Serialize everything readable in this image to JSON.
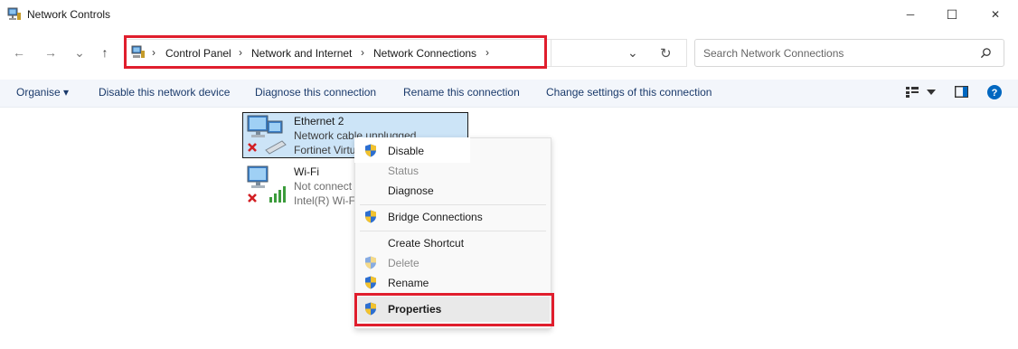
{
  "window": {
    "title": "Network Controls",
    "controls": {
      "minimize": "─",
      "maximize": "☐",
      "close": "✕"
    }
  },
  "nav": {
    "back": "←",
    "forward": "→",
    "recent": "⌄",
    "up": "↑"
  },
  "address": {
    "breadcrumbs": [
      "Control Panel",
      "Network and Internet",
      "Network Connections"
    ],
    "separator": "›",
    "dropdown": "⌄",
    "refresh": "↻"
  },
  "search": {
    "placeholder": "Search Network Connections"
  },
  "commands": {
    "organise": "Organise ▾",
    "disable": "Disable this network device",
    "diagnose": "Diagnose this connection",
    "rename": "Rename this connection",
    "change": "Change settings of this connection"
  },
  "connections": [
    {
      "name": "Ethernet 2",
      "status": "Network cable unplugged",
      "adapter": "Fortinet Virtu"
    },
    {
      "name": "Wi-Fi",
      "status": "Not connect",
      "adapter": "Intel(R) Wi-F"
    }
  ],
  "context_menu": {
    "disable": "Disable",
    "status": "Status",
    "diagnose": "Diagnose",
    "bridge": "Bridge Connections",
    "shortcut": "Create Shortcut",
    "delete": "Delete",
    "rename": "Rename",
    "properties": "Properties"
  },
  "colors": {
    "highlight": "#e01e2d",
    "selection": "#cce4f7",
    "help": "#0067c0"
  }
}
